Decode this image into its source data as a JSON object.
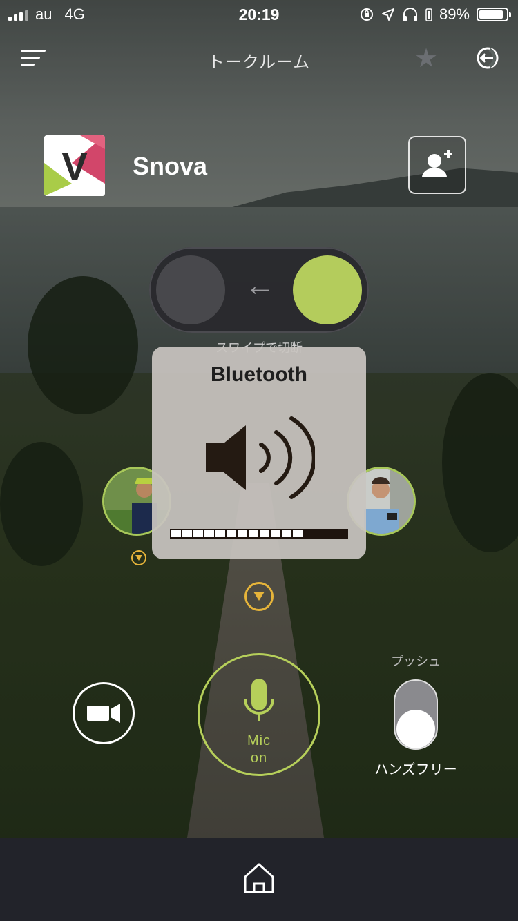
{
  "status_bar": {
    "carrier": "au",
    "network": "4G",
    "time": "20:19",
    "battery_percent": "89%",
    "battery_level": 0.89
  },
  "nav": {
    "title": "トークルーム",
    "menu_icon": "hamburger-icon",
    "favorite_icon": "star-icon",
    "exit_icon": "exit-icon"
  },
  "room": {
    "name": "Snova",
    "logo_icon": "v-logo",
    "add_member_icon": "add-user-icon"
  },
  "swipe_toggle": {
    "hint": "スワイプで切断",
    "arrow_icon": "left-arrow-icon"
  },
  "volume_hud": {
    "title": "Bluetooth",
    "icon": "speaker-volume-icon",
    "level_segments": 12,
    "total_segments": 16
  },
  "controls": {
    "video_icon": "video-camera-icon",
    "mic_label_line1": "Mic",
    "mic_label_line2": "on",
    "push_label": "プッシュ",
    "handsfree_label": "ハンズフリー"
  },
  "tabbar": {
    "home_icon": "home-icon"
  },
  "colors": {
    "accent_green": "#b6cf5a",
    "badge_gold": "#e6b43a",
    "tabbar_bg": "#22232a"
  }
}
